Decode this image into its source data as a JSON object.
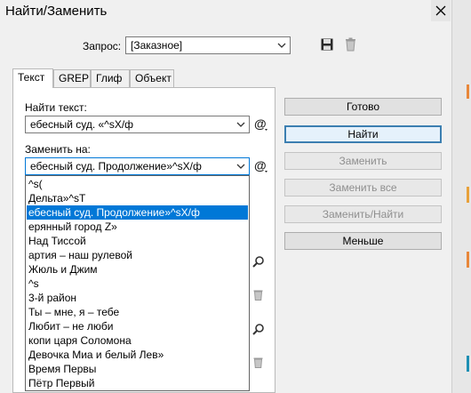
{
  "window": {
    "title": "Найти/Заменить"
  },
  "query": {
    "label": "Запрос:",
    "value": "[Заказное]"
  },
  "tabs": [
    "Текст",
    "GREP",
    "Глиф",
    "Объект"
  ],
  "find": {
    "label": "Найти текст:",
    "value": "ебесный суд. «^sX/ф"
  },
  "replace": {
    "label": "Заменить на:",
    "value": "ебесный суд. Продолжение»^sX/ф"
  },
  "buttons": {
    "done": "Готово",
    "find": "Найти",
    "replace": "Заменить",
    "replace_all": "Заменить все",
    "replace_find": "Заменить/Найти",
    "less": "Меньше"
  },
  "dropdown": {
    "selected_index": 2,
    "options": [
      "^s(",
      "Дельта»^sT",
      "ебесный суд. Продолжение»^sX/ф",
      "ерянный город Z»",
      "Над Тиссой",
      "артия – наш рулевой",
      "Жюль и Джим",
      "^s",
      "3-й район",
      "Ты – мне, я – тебе",
      "Любит – не люби",
      "копи царя Соломона",
      "Девочка Миа и белый Лев»",
      "Время Первы",
      "Пётр Первый"
    ]
  },
  "icons": {
    "save": "save-icon",
    "delete": "trash-icon",
    "special_chars": "at-icon",
    "search": "search-icon"
  },
  "colors": {
    "selection": "#0078d7",
    "default_button_border": "#3c7fb1"
  }
}
